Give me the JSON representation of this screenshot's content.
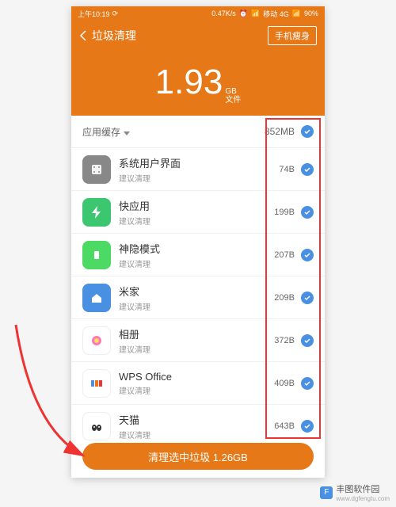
{
  "status": {
    "time": "上午10:19",
    "speed": "0.47K/s",
    "carrier": "移动 4G",
    "battery": "90%"
  },
  "header": {
    "title": "垃圾清理",
    "slim": "手机瘦身"
  },
  "total": {
    "value": "1.93",
    "unit": "GB",
    "sub": "文件"
  },
  "section": {
    "title": "应用缓存",
    "total": "852MB"
  },
  "apps": [
    {
      "name": "系统用户界面",
      "hint": "建议清理",
      "size": "74B",
      "icon": "ic-sys"
    },
    {
      "name": "快应用",
      "hint": "建议清理",
      "size": "199B",
      "icon": "ic-quick"
    },
    {
      "name": "神隐模式",
      "hint": "建议清理",
      "size": "207B",
      "icon": "ic-stealth"
    },
    {
      "name": "米家",
      "hint": "建议清理",
      "size": "209B",
      "icon": "ic-mihome"
    },
    {
      "name": "相册",
      "hint": "建议清理",
      "size": "372B",
      "icon": "ic-album"
    },
    {
      "name": "WPS Office",
      "hint": "建议清理",
      "size": "409B",
      "icon": "ic-wps"
    },
    {
      "name": "天猫",
      "hint": "建议清理",
      "size": "643B",
      "icon": "ic-tmall"
    }
  ],
  "action": {
    "label": "清理选中垃圾 1.26GB"
  },
  "watermark": {
    "name": "丰图软件园",
    "url": "www.dgfengtu.com"
  }
}
